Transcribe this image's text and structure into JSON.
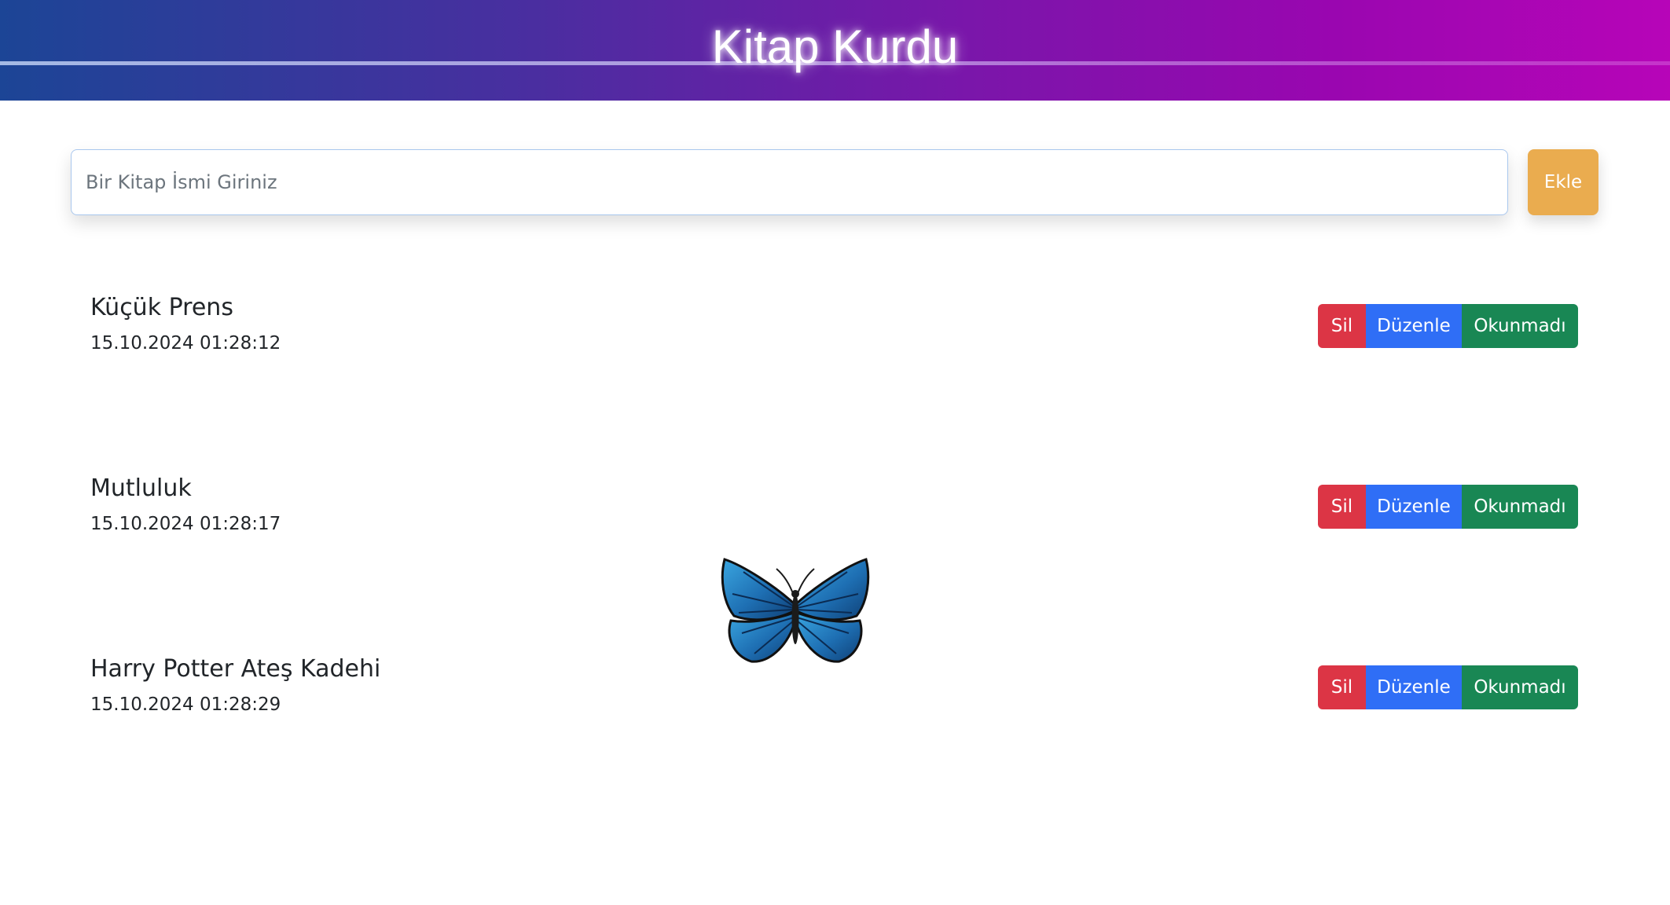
{
  "header": {
    "title": "Kitap Kurdu"
  },
  "search": {
    "placeholder": "Bir Kitap İsmi Giriniz",
    "value": ""
  },
  "add_button": {
    "label": "Ekle"
  },
  "books": [
    {
      "title": "Küçük Prens",
      "date": "15.10.2024 01:28:12",
      "delete_label": "Sil",
      "edit_label": "Düzenle",
      "status_label": "Okunmadı"
    },
    {
      "title": "Mutluluk",
      "date": "15.10.2024 01:28:17",
      "delete_label": "Sil",
      "edit_label": "Düzenle",
      "status_label": "Okunmadı"
    },
    {
      "title": "Harry Potter Ateş Kadehi",
      "date": "15.10.2024 01:28:29",
      "delete_label": "Sil",
      "edit_label": "Düzenle",
      "status_label": "Okunmadı"
    }
  ],
  "colors": {
    "delete": "#dc3545",
    "edit": "#2f6ef6",
    "status": "#198754",
    "add": "#eaac4f"
  },
  "decoration": {
    "icon": "butterfly-icon"
  }
}
